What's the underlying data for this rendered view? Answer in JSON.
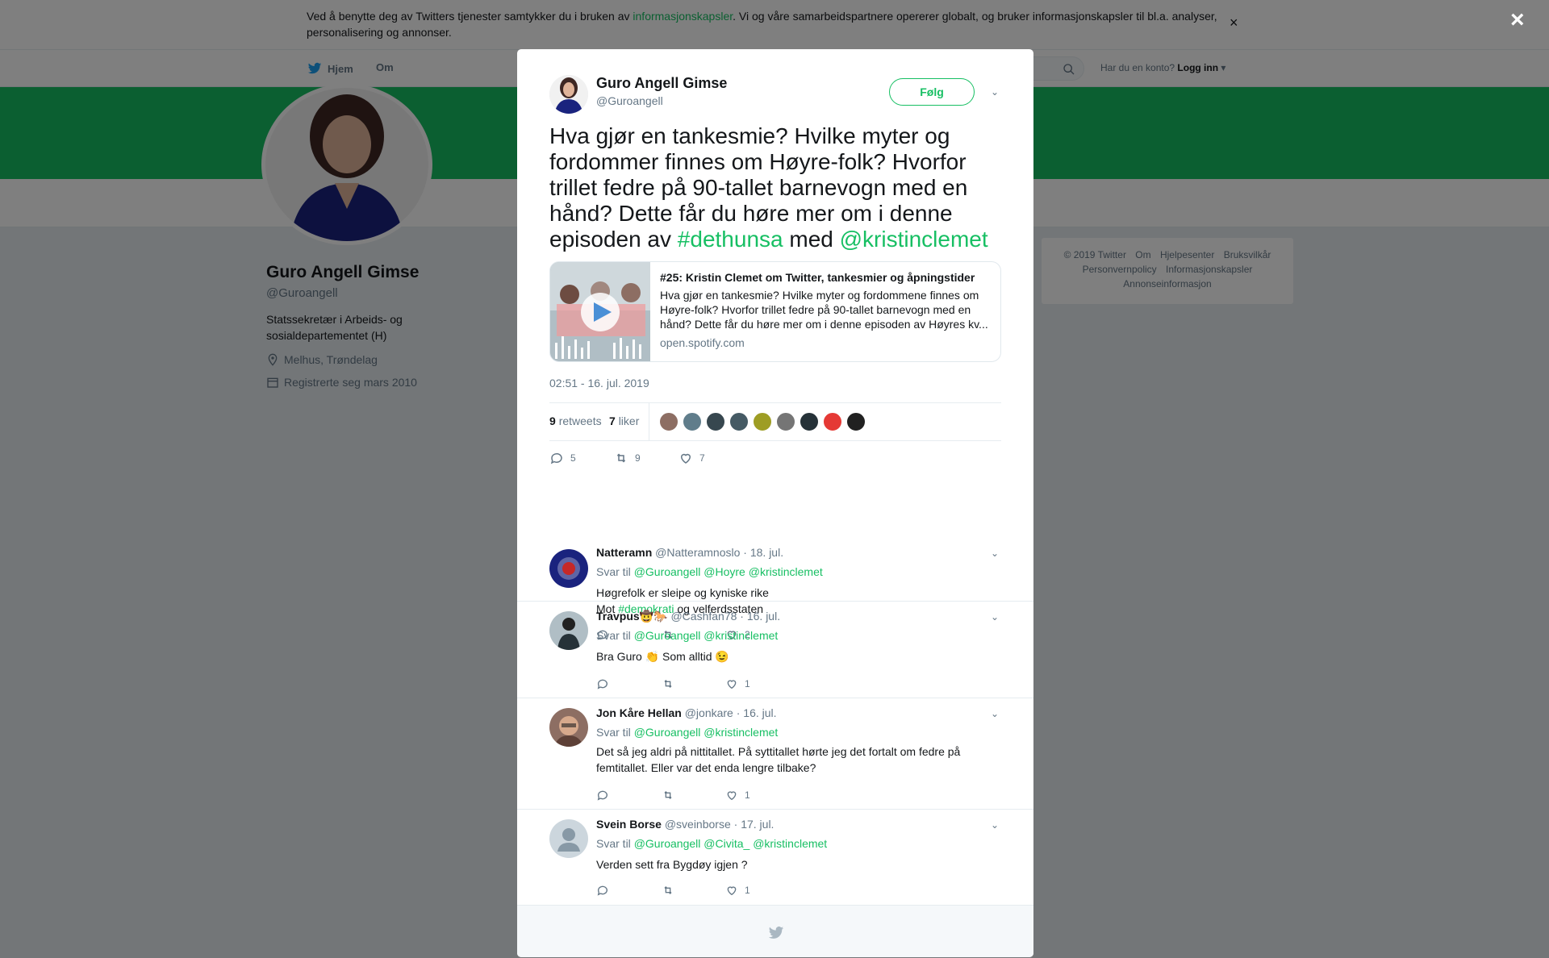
{
  "cookie": {
    "text_before": "Ved å benytte deg av Twitters tjenester samtykker du i bruken av ",
    "link": "informasjonskapsler",
    "text_after": ". Vi og våre samarbeidspartnere opererer globalt, og bruker informasjonskapsler til bl.a. analyser, personalisering og annonser.",
    "close": "×"
  },
  "nav": {
    "home": "Hjem",
    "about": "Om",
    "login_prompt": "Har du en konto?",
    "login": "Logg inn"
  },
  "profile": {
    "name": "Guro Angell Gimse",
    "handle": "@Guroangell",
    "bio": "Statssekretær i Arbeids- og sosialdepartementet (H)",
    "location": "Melhus, Trøndelag",
    "joined": "Registrerte seg mars 2010"
  },
  "footer": {
    "links": [
      "© 2019 Twitter",
      "Om",
      "Hjelpesenter",
      "Bruksvilkår",
      "Personvernpolicy",
      "Informasjonskapsler",
      "Annonseinformasjon"
    ]
  },
  "overlay_close": "×",
  "tweet": {
    "name": "Guro Angell Gimse",
    "handle": "@Guroangell",
    "follow": "Følg",
    "text_main": "Hva gjør en tankesmie?  Hvilke myter og fordommer finnes om Høyre-folk? Hvorfor trillet fedre på 90-tallet barnevogn med en hånd? Dette får du høre mer om i denne episoden av ",
    "hashtag": "#dethunsa",
    "text_mid": " med ",
    "mention": "@kristinclemet",
    "card": {
      "title": "#25: Kristin Clemet om Twitter, tankesmier og åpningstider",
      "description": "Hva gjør en tankesmie? Hvilke myter og fordommene finnes om Høyre-folk? Hvorfor trillet fedre på 90-tallet barnevogn med en hånd? Dette får du høre mer om i denne episoden av Høyres kv...",
      "url": "open.spotify.com"
    },
    "timestamp": "02:51 - 16. jul. 2019",
    "retweets_count": "9",
    "retweets_label": "retweets",
    "likes_count": "7",
    "likes_label": "liker",
    "reply_count": "5",
    "retweet_count": "9",
    "like_count": "7",
    "liker_colors": [
      "#8d6e63",
      "#607d8b",
      "#37474f",
      "#455a64",
      "#9e9d24",
      "#757575",
      "#263238",
      "#e53935",
      "#212121"
    ]
  },
  "replies": [
    {
      "name": "Natteramn",
      "handle": "@Natteramnoslo",
      "date": "· 18. jul.",
      "to_label": "Svar til",
      "to": [
        "@Guroangell",
        "@Hoyre",
        "@kristinclemet"
      ],
      "line1": "Høgrefolk er sleipe og kyniske rike",
      "line2_before": "Mot ",
      "line2_tag": "#demokrati",
      "line2_after": " og velferdsstaten",
      "likes": "2",
      "avatar_color": "#1a237e"
    },
    {
      "name": "Travpus",
      "handle": "@Cashfan78",
      "date": "· 16. jul.",
      "to_label": "Svar til",
      "to": [
        "@Guroangell",
        "@kristinclemet"
      ],
      "text_a": "Bra Guro ",
      "emoji_a": "👏",
      "text_b": " Som alltid ",
      "emoji_b": "😉",
      "likes": "1",
      "avatar_color": "#37474f"
    },
    {
      "name": "Jon Kåre Hellan",
      "handle": "@jonkare",
      "date": "· 16. jul.",
      "to_label": "Svar til",
      "to": [
        "@Guroangell",
        "@kristinclemet"
      ],
      "text": "Det så jeg aldri på nittitallet. På syttitallet hørte jeg det fortalt om fedre på femtitallet. Eller var det enda lengre tilbake?",
      "likes": "1",
      "avatar_color": "#795548"
    },
    {
      "name": "Svein Borse",
      "handle": "@sveinborse",
      "date": "· 17. jul.",
      "to_label": "Svar til",
      "to": [
        "@Guroangell",
        "@Civita_",
        "@kristinclemet"
      ],
      "text": "Verden sett fra Bygdøy igjen ?",
      "likes": "1",
      "avatar_color": "#ccd6dd"
    }
  ],
  "colors": {
    "accent": "#17bf63",
    "text": "#14171a",
    "muted": "#657786"
  }
}
